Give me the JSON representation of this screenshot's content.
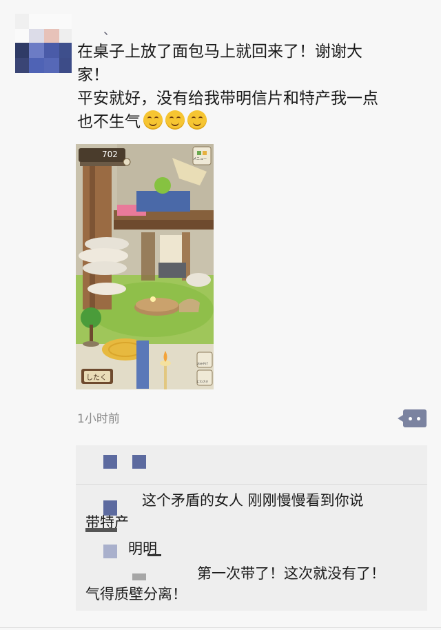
{
  "post": {
    "username_partial": "、",
    "text_lines": [
      "在桌子上放了面包马上就回来了！谢谢大",
      "家！",
      "平安就好，没有给我带明信片和特产我一点",
      "也不生气"
    ],
    "emoji_name": "smile-emoji",
    "emoji_count": 3,
    "timestamp": "1小时前"
  },
  "game_screenshot": {
    "currency_value": "702",
    "currency_icon": "clover-icon",
    "menu_label": "メニュー",
    "button_bottom_left": "したく",
    "button_right_1": "おみやげ",
    "button_right_2": "にわさき"
  },
  "comments": [
    {
      "text": "这个矛盾的女人 刚刚慢慢看到你说"
    },
    {
      "text": "带特产"
    },
    {
      "text": "明明"
    },
    {
      "text": "第一次带了！这次就没有了！"
    },
    {
      "text": "气得质壁分离！"
    }
  ],
  "colors": {
    "link_blue": "#576b95",
    "more_button": "#7b83a0",
    "comment_bg": "#eeeeee"
  }
}
